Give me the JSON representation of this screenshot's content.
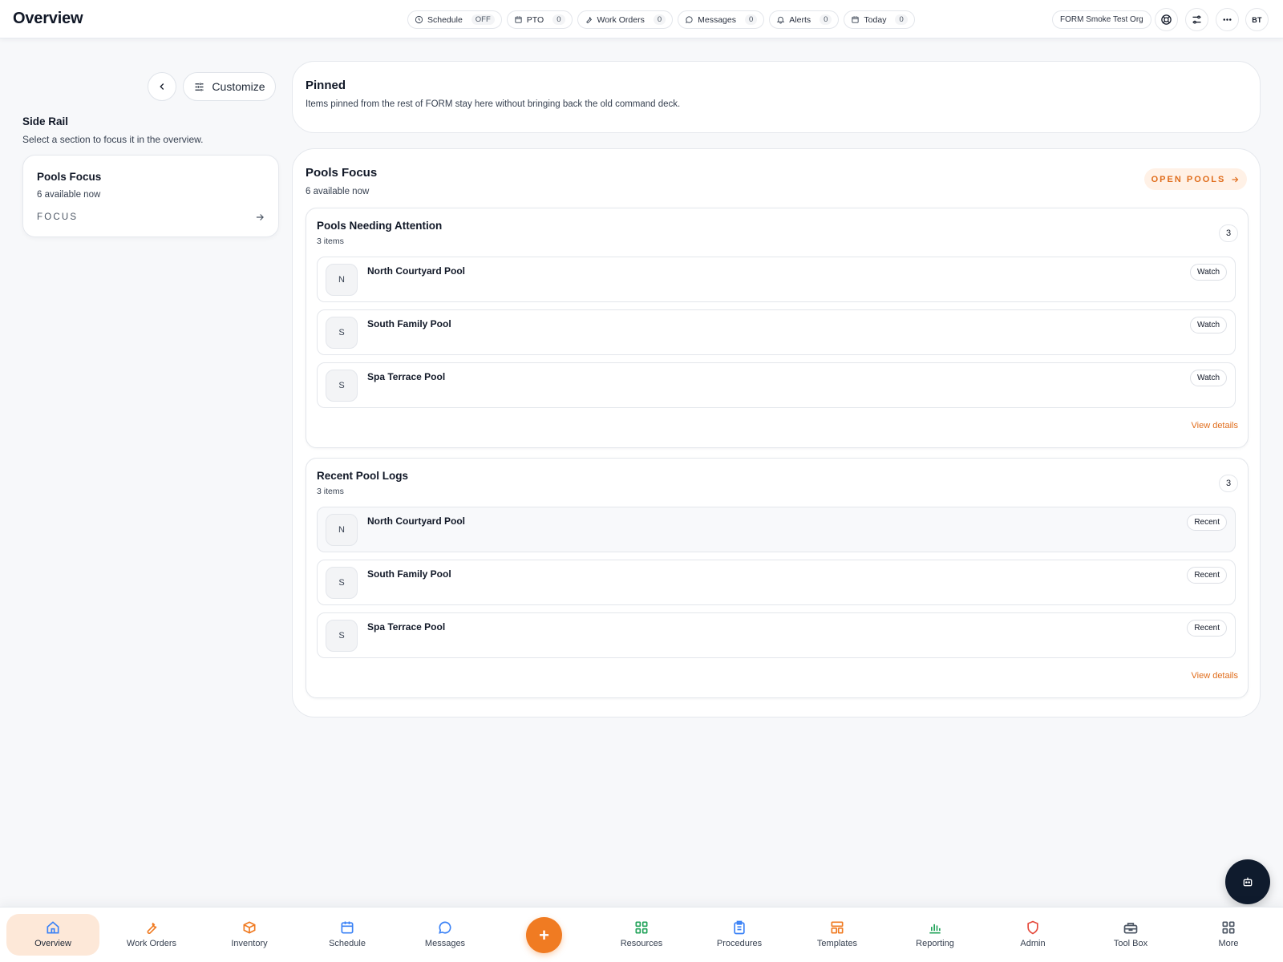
{
  "header": {
    "title": "Overview",
    "chips": [
      {
        "icon": "clock-icon",
        "label": "Schedule",
        "value": "OFF"
      },
      {
        "icon": "calendar-icon",
        "label": "PTO",
        "value": "0"
      },
      {
        "icon": "wrench-icon",
        "label": "Work Orders",
        "value": "0"
      },
      {
        "icon": "message-icon",
        "label": "Messages",
        "value": "0"
      },
      {
        "icon": "bell-icon",
        "label": "Alerts",
        "value": "0"
      },
      {
        "icon": "calendar-icon",
        "label": "Today",
        "value": "0"
      }
    ],
    "org": "FORM Smoke Test Org",
    "avatar": "BT"
  },
  "rail": {
    "customize_label": "Customize",
    "title": "Side Rail",
    "subtitle": "Select a section to focus it in the overview.",
    "card": {
      "title": "Pools Focus",
      "subtitle": "6 available now",
      "action": "FOCUS"
    }
  },
  "pinned": {
    "title": "Pinned",
    "subtitle": "Items pinned from the rest of FORM stay here without bringing back the old command deck."
  },
  "focus": {
    "title": "Pools Focus",
    "subtitle": "6 available now",
    "open_label": "OPEN POOLS",
    "sections": [
      {
        "title": "Pools Needing Attention",
        "subtitle": "3 items",
        "count": "3",
        "view_label": "View details",
        "rows": [
          {
            "initial": "N",
            "name": "North Courtyard Pool",
            "tag": "Watch"
          },
          {
            "initial": "S",
            "name": "South Family Pool",
            "tag": "Watch"
          },
          {
            "initial": "S",
            "name": "Spa Terrace Pool",
            "tag": "Watch"
          }
        ]
      },
      {
        "title": "Recent Pool Logs",
        "subtitle": "3 items",
        "count": "3",
        "view_label": "View details",
        "rows": [
          {
            "initial": "N",
            "name": "North Courtyard Pool",
            "tag": "Recent"
          },
          {
            "initial": "S",
            "name": "South Family Pool",
            "tag": "Recent"
          },
          {
            "initial": "S",
            "name": "Spa Terrace Pool",
            "tag": "Recent"
          }
        ]
      }
    ]
  },
  "nav": {
    "items": [
      {
        "label": "Overview",
        "icon": "home-icon",
        "color": "#3b82f6"
      },
      {
        "label": "Work Orders",
        "icon": "wrench-icon",
        "color": "#f07b22"
      },
      {
        "label": "Inventory",
        "icon": "package-icon",
        "color": "#f07b22"
      },
      {
        "label": "Schedule",
        "icon": "calendar-icon",
        "color": "#3b82f6"
      },
      {
        "label": "Messages",
        "icon": "message-icon",
        "color": "#3b82f6"
      },
      {
        "label": "Resources",
        "icon": "grid-icon",
        "color": "#22a35a"
      },
      {
        "label": "Procedures",
        "icon": "clipboard-icon",
        "color": "#3b82f6"
      },
      {
        "label": "Templates",
        "icon": "template-icon",
        "color": "#f07b22"
      },
      {
        "label": "Reporting",
        "icon": "bar-chart-icon",
        "color": "#22a35a"
      },
      {
        "label": "Admin",
        "icon": "shield-icon",
        "color": "#e5483a"
      },
      {
        "label": "Tool Box",
        "icon": "toolbox-icon",
        "color": "#4b5563"
      },
      {
        "label": "More",
        "icon": "grid-icon",
        "color": "#4b5563"
      }
    ],
    "plus_label": "+"
  },
  "colors": {
    "accent": "#f07b22",
    "navy": "#0f1b2d"
  }
}
